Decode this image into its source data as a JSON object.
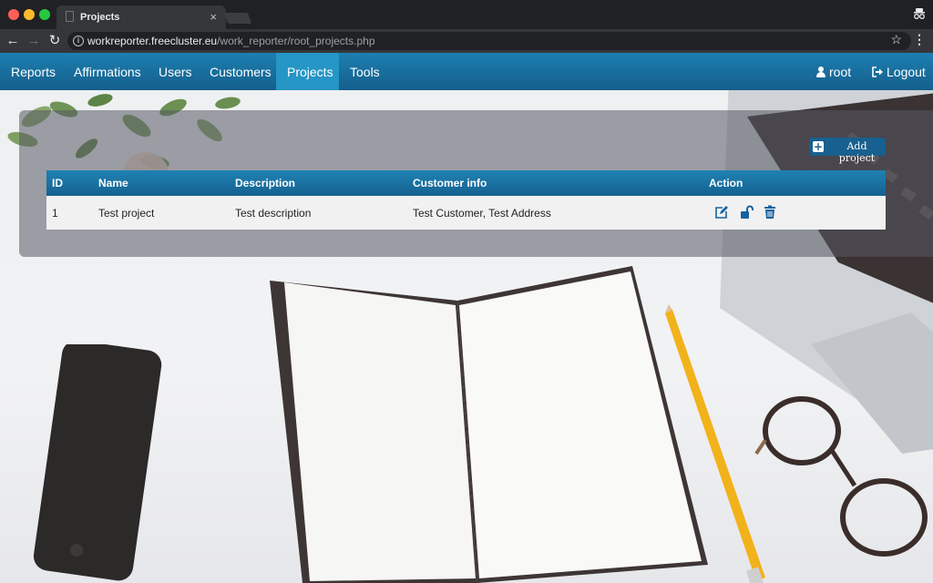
{
  "browser": {
    "tab_title": "Projects",
    "tab_close": "×",
    "url_host": "workreporter.freecluster.eu",
    "url_path": "/work_reporter/root_projects.php"
  },
  "nav": {
    "items": [
      {
        "label": "Reports",
        "active": false
      },
      {
        "label": "Affirmations",
        "active": false
      },
      {
        "label": "Users",
        "active": false
      },
      {
        "label": "Customers",
        "active": false
      },
      {
        "label": "Projects",
        "active": true
      },
      {
        "label": "Tools",
        "active": false
      }
    ],
    "user": "root",
    "logout": "Logout"
  },
  "panel": {
    "add_button": "Add project"
  },
  "table": {
    "headers": [
      "ID",
      "Name",
      "Description",
      "Customer info",
      "Action"
    ],
    "rows": [
      {
        "id": "1",
        "name": "Test project",
        "description": "Test description",
        "customer": "Test Customer, Test Address",
        "actions": [
          "edit-icon",
          "unlock-icon",
          "trash-icon"
        ]
      }
    ]
  },
  "colors": {
    "navbar": "#1c7fb0",
    "active_tab": "#2596c6",
    "action_icon": "#1664a0"
  }
}
